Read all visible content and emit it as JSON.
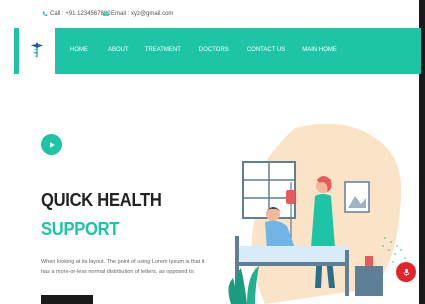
{
  "topbar": {
    "phone": "Call : +91 1234567890",
    "email": "Email : xyz@gmail.com",
    "phone_icon": "phone-icon",
    "email_icon": "envelope-icon"
  },
  "nav": {
    "logo_icon": "caduceus-icon",
    "items": [
      {
        "label": "HOME"
      },
      {
        "label": "ABOUT"
      },
      {
        "label": "TREATMENT"
      },
      {
        "label": "DOCTORS"
      },
      {
        "label": "CONTACT US"
      },
      {
        "label": "MAIN HOME"
      }
    ]
  },
  "hero": {
    "play_icon": "play-icon",
    "title_line1": "QUICK HEALTH",
    "title_line2": "SUPPORT",
    "description": "When looking at its layout. The point of using Lorem Ipsum is that it has a more-or-less normal distribution of letters, as opposed to.",
    "illustration": "patient-and-nurse-illustration",
    "fab_icon": "microphone-icon"
  },
  "colors": {
    "accent": "#1ec4a6",
    "dark": "#222222",
    "fab": "#e3252b"
  }
}
